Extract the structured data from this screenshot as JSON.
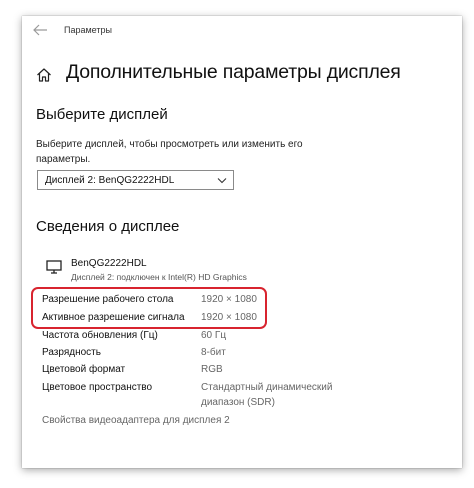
{
  "window": {
    "title": "Параметры"
  },
  "page": {
    "title": "Дополнительные параметры дисплея"
  },
  "select_display": {
    "heading": "Выберите дисплей",
    "description": "Выберите дисплей, чтобы просмотреть или изменить его параметры.",
    "dropdown_value": "Дисплей 2: BenQG2222HDL"
  },
  "display_info": {
    "heading": "Сведения о дисплее",
    "monitor_name": "BenQG2222HDL",
    "monitor_subtitle": "Дисплей 2: подключен к Intel(R) HD Graphics",
    "rows": [
      {
        "label": "Разрешение рабочего стола",
        "value": "1920 × 1080"
      },
      {
        "label": "Активное разрешение сигнала",
        "value": "1920 × 1080"
      },
      {
        "label": "Частота обновления (Гц)",
        "value": "60 Гц"
      },
      {
        "label": "Разрядность",
        "value": "8-бит"
      },
      {
        "label": "Цветовой формат",
        "value": "RGB"
      },
      {
        "label": "Цветовое пространство",
        "value": "Стандартный динамический диапазон (SDR)"
      }
    ],
    "adapter_link": "Свойства видеоадаптера для дисплея 2"
  },
  "colors": {
    "highlight": "#d8242f"
  }
}
